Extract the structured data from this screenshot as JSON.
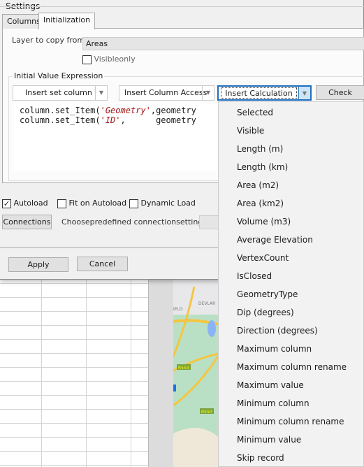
{
  "dialog": {
    "group_title": "Settings",
    "tabs": [
      {
        "label": "Columns"
      },
      {
        "label": "Initialization"
      }
    ],
    "layer_label": "Layer to copy from:",
    "layer_value": "Areas",
    "visible_only": {
      "label": "Visibleonly",
      "checked": false
    },
    "expression_group": "Initial Value Expression",
    "insert_set_column": "Insert set column",
    "insert_column_access": "Insert Column Access",
    "insert_calculation": "Insert Calculation",
    "check": "Check",
    "code": [
      {
        "prefix": "column.set_Item(",
        "str": "'Geometry'",
        "rest": ",geometry"
      },
      {
        "prefix": "column.set_Item(",
        "str": "'ID'",
        "rest": ",      geometry"
      }
    ],
    "autoload": {
      "label": "Autoload",
      "checked": true
    },
    "fit_on_autoload": {
      "label": "Fit on Autoload",
      "checked": false
    },
    "dynamic_load": {
      "label": "Dynamic Load",
      "checked": false
    },
    "connections": "Connections",
    "predefined_label": "Choosepredefined connectionsettings:",
    "apply": "Apply",
    "cancel": "Cancel"
  },
  "map": {
    "labels": [
      "DEVLAR",
      "IELD",
      "R554",
      "R550"
    ]
  },
  "menu": {
    "items": [
      "Selected",
      "Visible",
      "Length (m)",
      "Length (km)",
      "Area (m2)",
      "Area (km2)",
      "Volume (m3)",
      "Average Elevation",
      "VertexCount",
      "IsClosed",
      "GeometryType",
      "Dip (degrees)",
      "Direction (degrees)",
      "Maximum column",
      "Maximum column rename",
      "Maximum value",
      "Minimum column",
      "Minimum column rename",
      "Minimum value",
      "Skip record"
    ]
  }
}
